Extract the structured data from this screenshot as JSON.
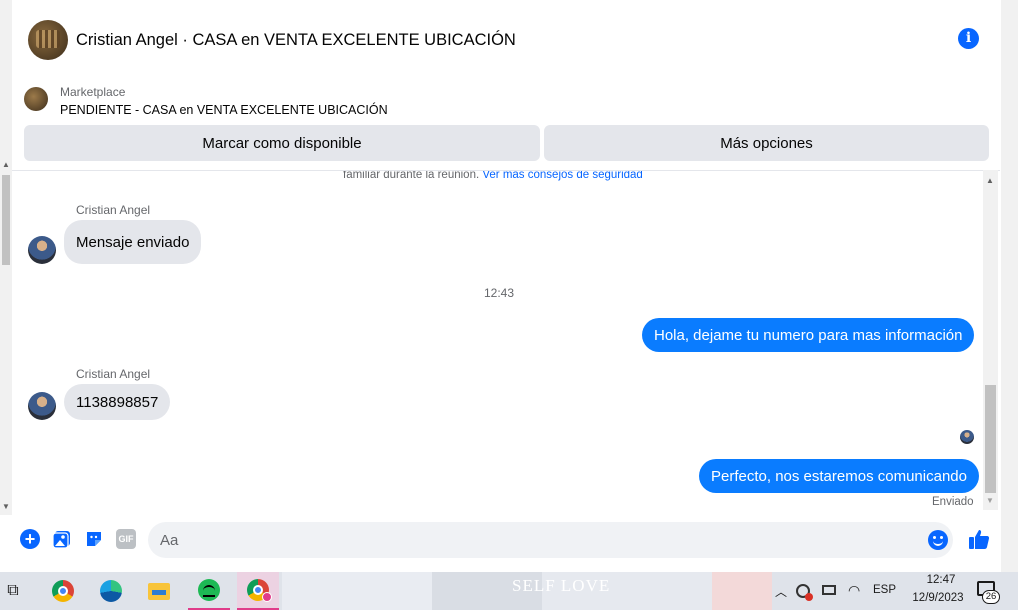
{
  "header": {
    "title": "Cristian Angel · CASA en VENTA EXCELENTE UBICACIÓN",
    "info_icon": "info-icon"
  },
  "marketplace": {
    "label": "Marketplace",
    "listing": "PENDIENTE - CASA en VENTA EXCELENTE UBICACIÓN",
    "btn_available": "Marcar como disponible",
    "btn_more": "Más opciones"
  },
  "conversation": {
    "safety_text": "familiar durante la reunión.",
    "safety_link": "Ver más consejos de seguridad",
    "messages": [
      {
        "sender": "Cristian Angel",
        "text": "Mensaje enviado",
        "direction": "in"
      },
      {
        "timestamp": "12:43"
      },
      {
        "text": "Hola, dejame tu numero para mas información",
        "direction": "out"
      },
      {
        "sender": "Cristian Angel",
        "text": "1138898857",
        "direction": "in"
      },
      {
        "text": "Perfecto, nos estaremos comunicando",
        "direction": "out"
      }
    ],
    "status": "Enviado"
  },
  "composer": {
    "placeholder": "Aa",
    "gif_label": "GIF"
  },
  "taskbar": {
    "wallpaper_text": "SELF LOVE",
    "lang": "ESP",
    "time": "12:47",
    "date": "12/9/2023",
    "notification_count": "26"
  },
  "colors": {
    "accent": "#0866ff",
    "outgoing_bubble": "#0a7cff",
    "incoming_bubble": "#e4e6eb"
  }
}
